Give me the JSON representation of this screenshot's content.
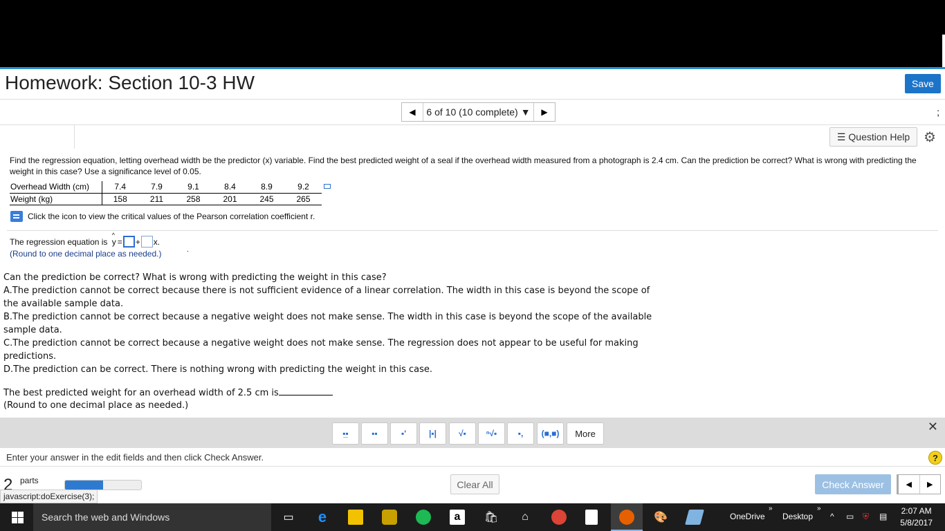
{
  "header": {
    "title": "Homework: Section 10-3 HW",
    "save_label": "Save"
  },
  "nav": {
    "position_text": "6 of 10 (10 complete)",
    "right_mark": ";"
  },
  "help": {
    "question_help_label": "Question Help"
  },
  "problem": {
    "text": "Find the regression equation, letting overhead width be the predictor (x) variable. Find the best predicted weight of a seal if the overhead width measured from a photograph is 2.4 cm. Can the prediction be correct? What is wrong with predicting the weight in this case? Use a significance level of 0.05.",
    "table": {
      "row1_label": "Overhead Width (cm)",
      "row1_values": [
        "7.4",
        "7.9",
        "9.1",
        "8.4",
        "8.9",
        "9.2"
      ],
      "row2_label": "Weight (kg)",
      "row2_values": [
        "158",
        "211",
        "258",
        "201",
        "245",
        "265"
      ]
    },
    "pearson_text": "Click the icon to view the critical values of the Pearson correlation coefficient r."
  },
  "regression": {
    "prefix": "The regression equation is",
    "y_hat": "y",
    "equals": "=",
    "plus": "+",
    "x_suffix": "x.",
    "note": "(Round to one decimal place as needed.)",
    "dot": "."
  },
  "question": {
    "prompt": "Can the prediction be correct? What is wrong with predicting the weight in this case?",
    "options": [
      "A.The prediction cannot be correct because there is not sufficient evidence of a linear correlation. The width in this case is beyond the scope of the available sample data.",
      "B.The prediction cannot be correct because a negative weight does not make sense. The width in this case is beyond the scope of the available sample data.",
      "C.The prediction cannot be correct because a negative weight does not make sense. The regression does not appear to be useful for making predictions.",
      "D.The prediction can be correct. There is nothing wrong with predicting the weight in this case."
    ]
  },
  "best_prediction": {
    "text": "The best predicted weight for an overhead width of 2.5 cm is",
    "note": "(Round to one decimal place as needed.)"
  },
  "toolbar": {
    "more_label": "More",
    "buttons": [
      "fraction",
      "mixed-number",
      "exponent",
      "absolute-value",
      "square-root",
      "nth-root",
      "subscript",
      "ordered-pair"
    ],
    "ordered_pair_label": "(■,■)"
  },
  "footer": {
    "instruction": "Enter your answer in the edit fields and then click Check Answer.",
    "help_symbol": "?",
    "parts_number": "2",
    "parts_label": "parts",
    "progress_fraction": 0.5,
    "clear_all_label": "Clear All",
    "check_answer_label": "Check Answer",
    "status_url": "javascript:doExercise(3);"
  },
  "taskbar": {
    "search_placeholder": "Search the web and Windows",
    "onedrive": "OneDrive",
    "desktop": "Desktop",
    "time": "2:07 AM",
    "date": "5/8/2017"
  },
  "colors": {
    "accent": "#1c74c9",
    "check_answer_disabled": "#9cc0e3",
    "taskbar": "#1c1c1c"
  }
}
